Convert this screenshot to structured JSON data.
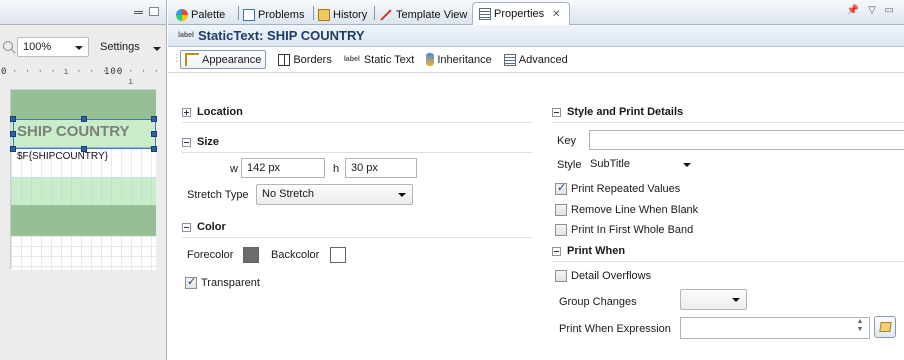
{
  "left_pane": {
    "zoom_value": "100%",
    "settings_label": "Settings",
    "ruler": {
      "start": "0",
      "mark": "100"
    },
    "canvas": {
      "static_text": "SHIP COUNTRY",
      "field_text": "$F{SHIPCOUNTRY}"
    }
  },
  "tabs": [
    {
      "label": "Palette",
      "icon": "palette-icon"
    },
    {
      "label": "Problems",
      "icon": "problems-icon"
    },
    {
      "label": "History",
      "icon": "history-icon"
    },
    {
      "label": "Template View",
      "icon": "template-view-icon"
    },
    {
      "label": "Properties",
      "icon": "properties-icon",
      "active": true
    }
  ],
  "properties": {
    "title": "StaticText: SHIP COUNTRY",
    "title_icon": "label",
    "subtabs": [
      {
        "label": "Appearance",
        "active": true
      },
      {
        "label": "Borders"
      },
      {
        "label": "Static Text",
        "icon_text": "label"
      },
      {
        "label": "Inheritance"
      },
      {
        "label": "Advanced"
      }
    ],
    "location": {
      "header": "Location"
    },
    "size": {
      "header": "Size",
      "w_label": "w",
      "w_value": "142 px",
      "h_label": "h",
      "h_value": "30 px",
      "stretch_label": "Stretch Type",
      "stretch_value": "No Stretch"
    },
    "color": {
      "header": "Color",
      "forecolor_label": "Forecolor",
      "forecolor": "#6b6b6b",
      "backcolor_label": "Backcolor",
      "backcolor": "#ffffff",
      "transparent_label": "Transparent",
      "transparent_checked": true
    },
    "style_print": {
      "header": "Style and Print Details",
      "key_label": "Key",
      "key_value": "",
      "style_label": "Style",
      "style_value": "SubTitle",
      "print_repeated": "Print Repeated Values",
      "remove_line": "Remove Line When Blank",
      "print_first_band": "Print In First Whole Band"
    },
    "print_when": {
      "header": "Print When",
      "detail_overflows": "Detail Overflows",
      "group_changes_label": "Group Changes",
      "group_changes_value": "",
      "expression_label": "Print When Expression",
      "expression_value": ""
    }
  },
  "colors": {
    "band_dark": "#96bf96",
    "band_light": "#c9ecc9",
    "selection": "#2f5fa7",
    "title_text": "#1f3b67"
  }
}
